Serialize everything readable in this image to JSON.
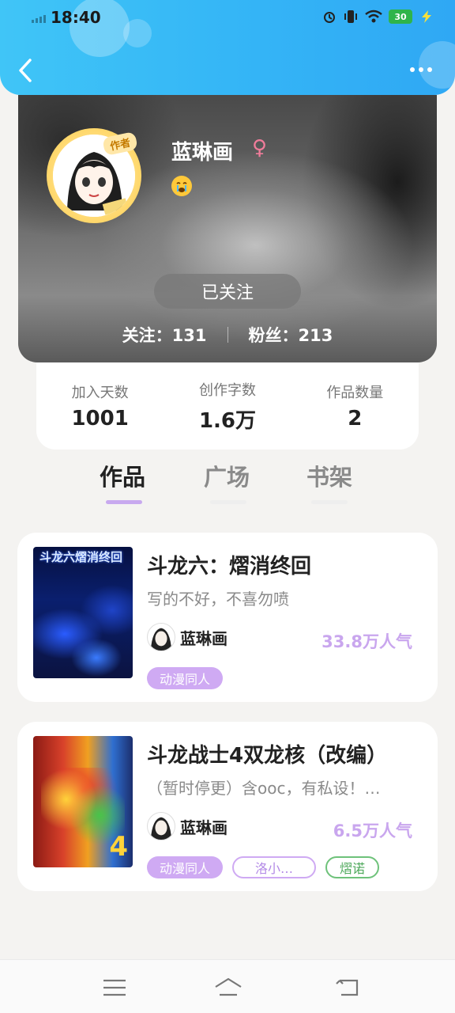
{
  "status_bar": {
    "time": "18:40",
    "battery": "30",
    "icons": [
      "signal-icon",
      "alarm-icon",
      "vibrate-icon",
      "wifi-icon",
      "battery-icon",
      "charging-icon"
    ]
  },
  "header": {
    "back_icon": "chevron-left-icon",
    "more_icon": "more-dots-icon",
    "accent_color": "#35b6f6"
  },
  "profile": {
    "badge": "作者",
    "username": "蓝琳画",
    "gender_symbol": "♀",
    "mood_icon": "crying-emoji-icon",
    "follow_button": "已关注",
    "following_label": "关注：131",
    "followers_label": "粉丝：213"
  },
  "stats": [
    {
      "label": "加入天数",
      "value": "1001"
    },
    {
      "label": "创作字数",
      "value": "1.6万"
    },
    {
      "label": "作品数量",
      "value": "2"
    }
  ],
  "tabs": [
    {
      "label": "作品",
      "active": true
    },
    {
      "label": "广场",
      "active": false
    },
    {
      "label": "书架",
      "active": false
    }
  ],
  "works": [
    {
      "title": "斗龙六：熠消终回",
      "description": "写的不好，不喜勿喷",
      "author": "蓝琳画",
      "popularity": "33.8万人气",
      "cover_text": "斗龙六熠消终回",
      "tags": [
        {
          "label": "动漫同人",
          "style": "filled"
        }
      ]
    },
    {
      "title": "斗龙战士4双龙核（改编）",
      "description": "（暂时停更）含ooc，有私设！…",
      "author": "蓝琳画",
      "popularity": "6.5万人气",
      "cover_text": "4",
      "tags": [
        {
          "label": "动漫同人",
          "style": "filled"
        },
        {
          "label": "洛小…",
          "style": "outline-purple"
        },
        {
          "label": "熠诺",
          "style": "outline-green"
        }
      ]
    }
  ],
  "navbar": {
    "icons": [
      "menu-icon",
      "home-icon",
      "back-icon"
    ]
  }
}
